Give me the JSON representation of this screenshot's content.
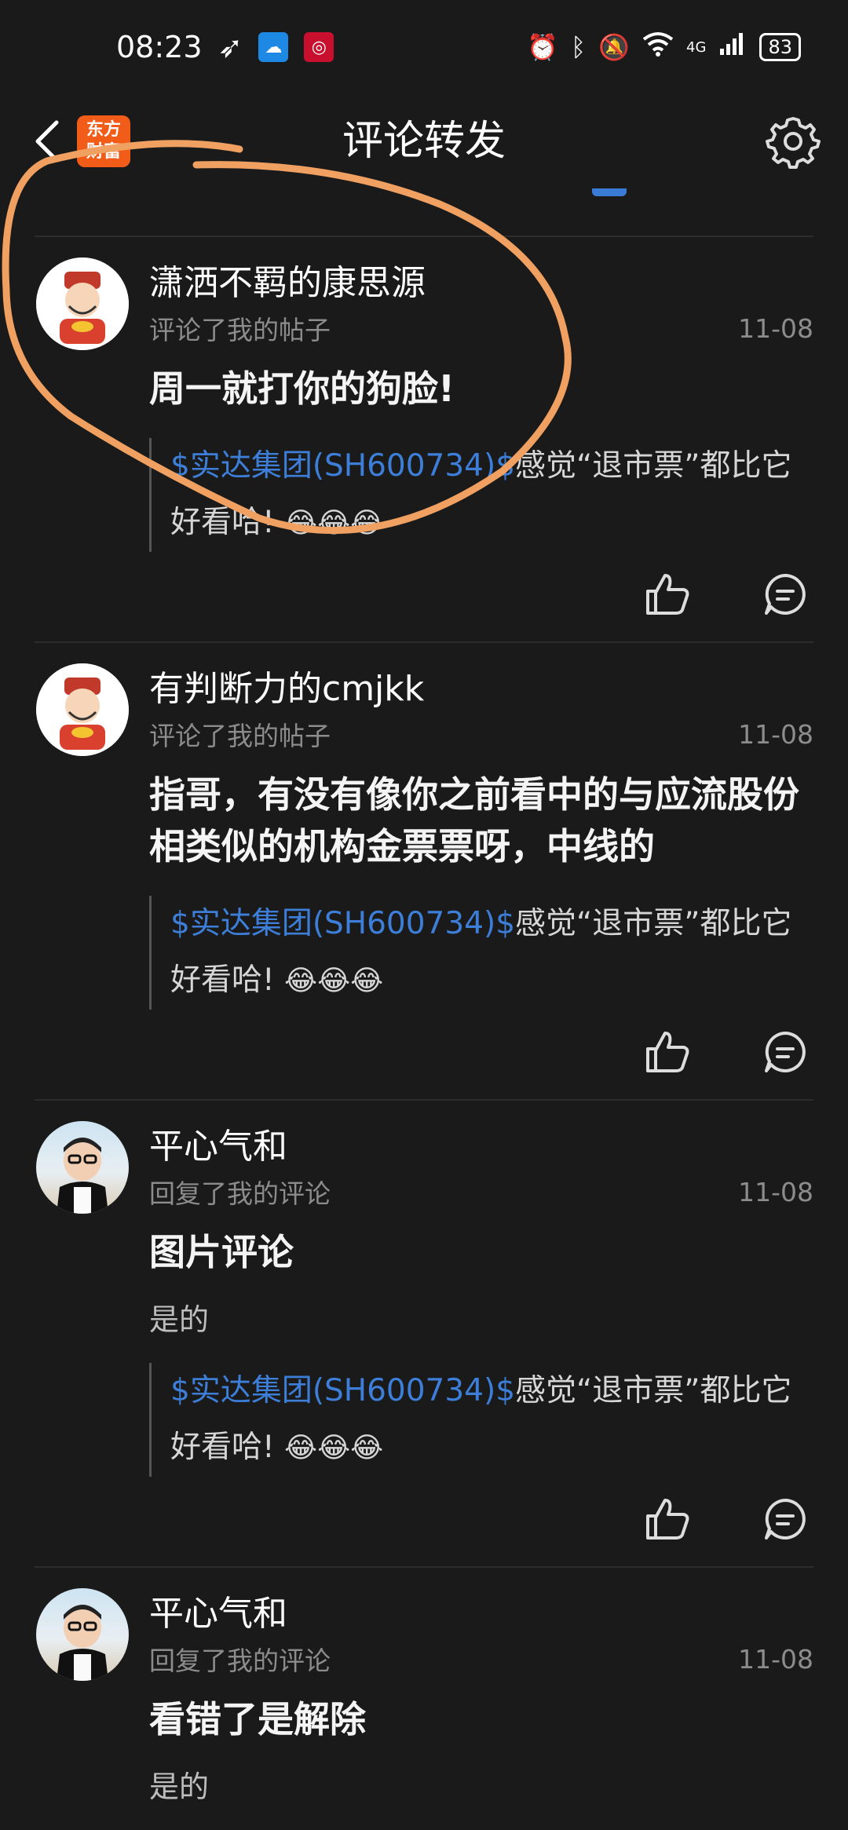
{
  "status": {
    "time": "08:23",
    "network": "4G",
    "battery": "83"
  },
  "header": {
    "title": "评论转发",
    "brand_line1": "东方",
    "brand_line2": "财富"
  },
  "posts": [
    {
      "username": "潇洒不羁的康思源",
      "action": "评论了我的帖子",
      "date": "11-08",
      "comment": "周一就打你的狗脸!",
      "subtext": "",
      "quote_stock": "$实达集团(SH600734)$",
      "quote_text": "感觉“退市票”都比它好看哈!",
      "emojis": "😂😂😂"
    },
    {
      "username": "有判断力的cmjkk",
      "action": "评论了我的帖子",
      "date": "11-08",
      "comment": "指哥，有没有像你之前看中的与应流股份相类似的机构金票票呀，中线的",
      "subtext": "",
      "quote_stock": "$实达集团(SH600734)$",
      "quote_text": "感觉“退市票”都比它好看哈!",
      "emojis": "😂😂😂"
    },
    {
      "username": "平心气和",
      "action": "回复了我的评论",
      "date": "11-08",
      "comment": "图片评论",
      "subtext": "是的",
      "quote_stock": "$实达集团(SH600734)$",
      "quote_text": "感觉“退市票”都比它好看哈!",
      "emojis": "😂😂😂"
    },
    {
      "username": "平心气和",
      "action": "回复了我的评论",
      "date": "11-08",
      "comment": "看错了是解除",
      "subtext": "是的"
    }
  ],
  "colors": {
    "background": "#1a1a1a",
    "stock_link": "#3c7ed8",
    "brand": "#f25c19",
    "annotation": "#f0a060"
  }
}
